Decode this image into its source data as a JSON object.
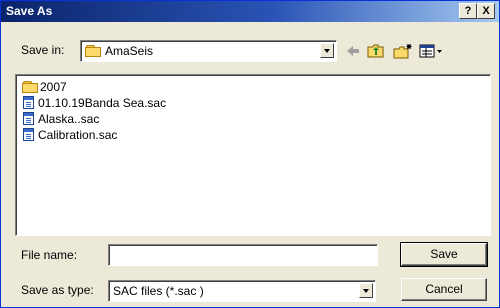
{
  "window": {
    "title": "Save As",
    "help_label": "?",
    "close_label": "X"
  },
  "toolbar": {
    "save_in_label": "Save in:",
    "save_in_value": "AmaSeis",
    "icons": [
      "back-arrow-icon",
      "up-folder-icon",
      "new-folder-icon",
      "view-menu-icon"
    ]
  },
  "file_list": {
    "items": [
      {
        "name": "2007",
        "type": "folder"
      },
      {
        "name": "01.10.19Banda Sea.sac",
        "type": "file"
      },
      {
        "name": "Alaska..sac",
        "type": "file"
      },
      {
        "name": "Calibration.sac",
        "type": "file"
      }
    ]
  },
  "form": {
    "file_name_label": "File name:",
    "file_name_value": "",
    "save_type_label": "Save as type:",
    "save_type_value": "SAC files (*.sac )"
  },
  "buttons": {
    "save_label": "Save",
    "cancel_label": "Cancel"
  }
}
